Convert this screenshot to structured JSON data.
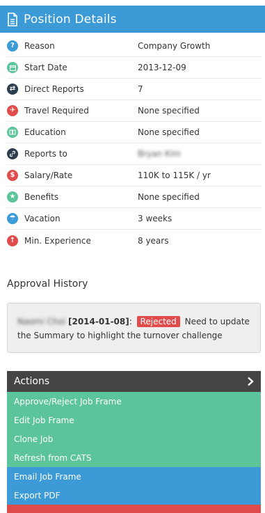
{
  "panel": {
    "title": "Position Details"
  },
  "details": [
    {
      "label": "Reason",
      "value": "Company Growth",
      "icon": "question-icon",
      "color": "#3c9ad6"
    },
    {
      "label": "Start Date",
      "value": "2013-12-09",
      "icon": "calendar-icon",
      "color": "#5cc49a"
    },
    {
      "label": "Direct Reports",
      "value": "7",
      "icon": "arrows-icon",
      "color": "#2c3e50"
    },
    {
      "label": "Travel Required",
      "value": "None specified",
      "icon": "plane-icon",
      "color": "#e04c4c"
    },
    {
      "label": "Education",
      "value": "None specified",
      "icon": "book-icon",
      "color": "#5cc49a"
    },
    {
      "label": "Reports to",
      "value": "Bryan Kim",
      "icon": "link-icon",
      "color": "#2c3e50"
    },
    {
      "label": "Salary/Rate",
      "value": "110K to 115K / yr",
      "icon": "dollar-icon",
      "color": "#e04c4c"
    },
    {
      "label": "Benefits",
      "value": "None specified",
      "icon": "star-icon",
      "color": "#5cc49a"
    },
    {
      "label": "Vacation",
      "value": "3 weeks",
      "icon": "umbrella-icon",
      "color": "#3c9ad6"
    },
    {
      "label": "Min. Experience",
      "value": "8 years",
      "icon": "up-arrow-icon",
      "color": "#e04c4c"
    }
  ],
  "approval": {
    "title": "Approval History",
    "who": "Naomi Choi",
    "date": "[2014-01-08]",
    "status": "Rejected",
    "note": "Need to update the Summary to highlight the turnover challenge"
  },
  "actions": {
    "title": "Actions",
    "items": [
      {
        "label": "Approve/Reject Job Frame"
      },
      {
        "label": "Edit Job Frame"
      },
      {
        "label": "Clone Job"
      },
      {
        "label": "Refresh from CATS"
      },
      {
        "label": "Email Job Frame"
      },
      {
        "label": "Export PDF"
      }
    ]
  },
  "colors": {
    "primary": "#3c9ad6",
    "success": "#5cc49a",
    "danger": "#e04c4c",
    "dark": "#444444"
  }
}
